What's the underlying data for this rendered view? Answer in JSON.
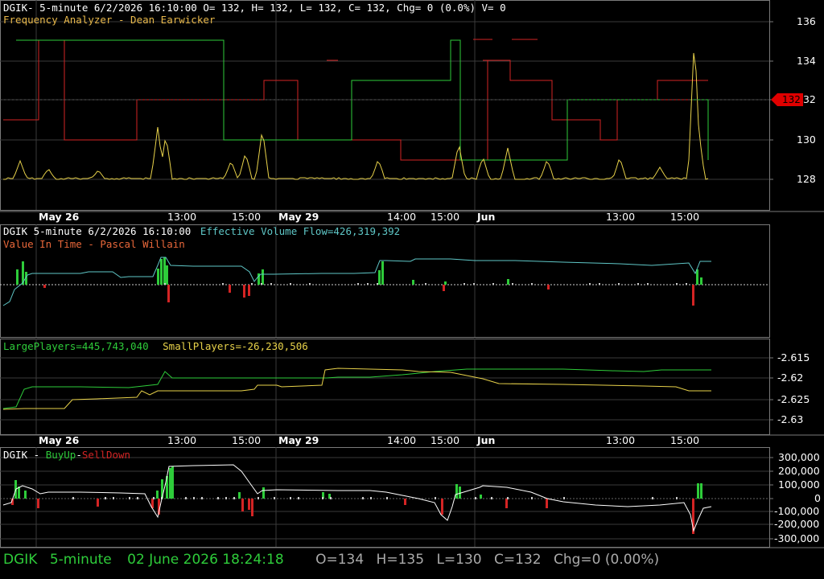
{
  "colors": {
    "green": "#2ecc3a",
    "red": "#d42424",
    "yellow": "#e8d24a",
    "cyan": "#5fc7c7",
    "salmon": "#e8673a",
    "white": "#ffffff",
    "grid": "#3a3a3a",
    "border": "#7a7a7a"
  },
  "panel1": {
    "header": "DGIK- 5-minute 6/2/2026 16:10:00 O= 132, H= 132, L= 132, C= 132, Chg= 0 (0.0%) V= 0",
    "indicator": "Frequency Analyzer - Dean Earwicker",
    "y_ticks": [
      "136",
      "134",
      "132",
      "130",
      "128"
    ],
    "price_marker": "132"
  },
  "time_axis": {
    "labels": [
      "May 26",
      "13:00",
      "15:00",
      "May 29",
      "14:00",
      "15:00",
      "Jun",
      "13:00",
      "15:00"
    ],
    "bold": [
      true,
      false,
      false,
      true,
      false,
      false,
      true,
      false,
      false
    ]
  },
  "panel2": {
    "header_symbol": "DGIK 5-minute  6/2/2026 16:10:00",
    "header_flow": "Effective Volume Flow=426,319,392",
    "indicator": "Value In Time - Pascal Willain"
  },
  "panel3": {
    "large": "LargePlayers=445,743,040",
    "small": "SmallPlayers=-26,230,506",
    "y_ticks": [
      "-2.615",
      "-2.62",
      "-2.625",
      "-2.63"
    ]
  },
  "panel4": {
    "symbol": "DGIK - ",
    "buyup": "BuyUp",
    "dash": "-",
    "selldown": "SellDown",
    "y_ticks": [
      "300,000",
      "200,000",
      "100,000",
      "0",
      "-100,000",
      "-200,000",
      "-300,000"
    ]
  },
  "status": {
    "symbol": "DGIK",
    "interval": "5-minute",
    "datetime": "02 June 2026 18:24:18",
    "open": "O=134",
    "high": "H=135",
    "low": "L=130",
    "close": "C=132",
    "change": "Chg=0 (0.00%)"
  }
}
